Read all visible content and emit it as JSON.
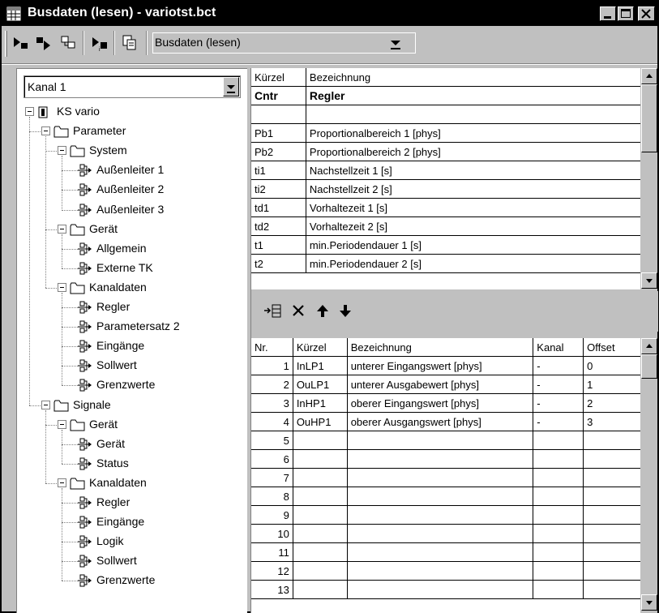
{
  "window": {
    "title": "Busdaten (lesen) - variotst.bct"
  },
  "toolbar": {
    "view_combo_value": "Busdaten (lesen)"
  },
  "channel_combo": {
    "value": "Kanal 1"
  },
  "tree": [
    {
      "id": "ks-vario",
      "label": "KS vario",
      "level": 0,
      "type": "device",
      "expanded": true
    },
    {
      "id": "parameter",
      "label": "Parameter",
      "level": 1,
      "type": "folder",
      "expanded": true
    },
    {
      "id": "system",
      "label": "System",
      "level": 2,
      "type": "folder",
      "expanded": true
    },
    {
      "id": "aussenleiter-1",
      "label": "Außenleiter 1",
      "level": 3,
      "type": "leaf"
    },
    {
      "id": "aussenleiter-2",
      "label": "Außenleiter 2",
      "level": 3,
      "type": "leaf"
    },
    {
      "id": "aussenleiter-3",
      "label": "Außenleiter 3",
      "level": 3,
      "type": "leaf"
    },
    {
      "id": "geraet-param",
      "label": "Gerät",
      "level": 2,
      "type": "folder",
      "expanded": true
    },
    {
      "id": "allgemein",
      "label": "Allgemein",
      "level": 3,
      "type": "leaf"
    },
    {
      "id": "externe-tk",
      "label": "Externe TK",
      "level": 3,
      "type": "leaf"
    },
    {
      "id": "kanaldaten-param",
      "label": "Kanaldaten",
      "level": 2,
      "type": "folder",
      "expanded": true
    },
    {
      "id": "regler-param",
      "label": "Regler",
      "level": 3,
      "type": "leaf"
    },
    {
      "id": "parametersatz-2",
      "label": "Parametersatz 2",
      "level": 3,
      "type": "leaf"
    },
    {
      "id": "eingaenge-param",
      "label": "Eingänge",
      "level": 3,
      "type": "leaf"
    },
    {
      "id": "sollwert-param",
      "label": "Sollwert",
      "level": 3,
      "type": "leaf"
    },
    {
      "id": "grenzwerte-param",
      "label": "Grenzwerte",
      "level": 3,
      "type": "leaf"
    },
    {
      "id": "signale",
      "label": "Signale",
      "level": 1,
      "type": "folder",
      "expanded": true
    },
    {
      "id": "geraet-sig",
      "label": "Gerät",
      "level": 2,
      "type": "folder",
      "expanded": true
    },
    {
      "id": "geraet-leaf",
      "label": "Gerät",
      "level": 3,
      "type": "leaf"
    },
    {
      "id": "status",
      "label": "Status",
      "level": 3,
      "type": "leaf"
    },
    {
      "id": "kanaldaten-sig",
      "label": "Kanaldaten",
      "level": 2,
      "type": "folder",
      "expanded": true
    },
    {
      "id": "regler-sig",
      "label": "Regler",
      "level": 3,
      "type": "leaf"
    },
    {
      "id": "eingaenge-sig",
      "label": "Eingänge",
      "level": 3,
      "type": "leaf"
    },
    {
      "id": "logik",
      "label": "Logik",
      "level": 3,
      "type": "leaf"
    },
    {
      "id": "sollwert-sig",
      "label": "Sollwert",
      "level": 3,
      "type": "leaf"
    },
    {
      "id": "grenzwerte-sig",
      "label": "Grenzwerte",
      "level": 3,
      "type": "leaf"
    }
  ],
  "param_table": {
    "headers": [
      "Kürzel",
      "Bezeichnung"
    ],
    "group_row": [
      "Cntr",
      "Regler"
    ],
    "rows": [
      [
        "",
        ""
      ],
      [
        "Pb1",
        "Proportionalbereich 1 [phys]"
      ],
      [
        "Pb2",
        "Proportionalbereich 2 [phys]"
      ],
      [
        "ti1",
        "Nachstellzeit 1 [s]"
      ],
      [
        "ti2",
        "Nachstellzeit 2 [s]"
      ],
      [
        "td1",
        "Vorhaltezeit 1 [s]"
      ],
      [
        "td2",
        "Vorhaltezeit 2 [s]"
      ],
      [
        "t1",
        "min.Periodendauer 1 [s]"
      ],
      [
        "t2",
        "min.Periodendauer 2 [s]"
      ]
    ]
  },
  "bus_table": {
    "headers": [
      "Nr.",
      "Kürzel",
      "Bezeichnung",
      "Kanal",
      "Offset"
    ],
    "rows": [
      [
        "1",
        "InLP1",
        "unterer Eingangswert [phys]",
        "-",
        "0"
      ],
      [
        "2",
        "OuLP1",
        "unterer Ausgabewert [phys]",
        "-",
        "1"
      ],
      [
        "3",
        "InHP1",
        "oberer Eingangswert [phys]",
        "-",
        "2"
      ],
      [
        "4",
        "OuHP1",
        "oberer Ausgangswert [phys]",
        "-",
        "3"
      ],
      [
        "5",
        "",
        "",
        "",
        ""
      ],
      [
        "6",
        "",
        "",
        "",
        ""
      ],
      [
        "7",
        "",
        "",
        "",
        ""
      ],
      [
        "8",
        "",
        "",
        "",
        ""
      ],
      [
        "9",
        "",
        "",
        "",
        ""
      ],
      [
        "10",
        "",
        "",
        "",
        ""
      ],
      [
        "11",
        "",
        "",
        "",
        ""
      ],
      [
        "12",
        "",
        "",
        "",
        ""
      ],
      [
        "13",
        "",
        "",
        "",
        ""
      ]
    ]
  },
  "icons": {
    "title": "table-icon",
    "toolbar": [
      "read-from-device-icon",
      "write-to-device-icon",
      "compare-icon",
      "device-info-icon",
      "copy-icon"
    ],
    "bus_toolbar": [
      "insert-row-icon",
      "delete-icon",
      "move-up-icon",
      "move-down-icon"
    ]
  }
}
